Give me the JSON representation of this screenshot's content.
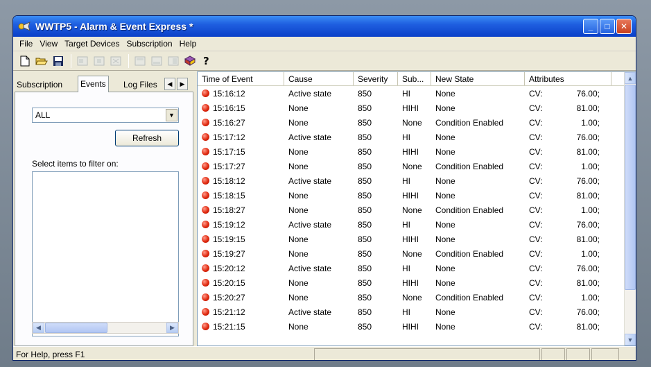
{
  "window": {
    "title": "WWTP5 - Alarm & Event Express *",
    "controls": {
      "minimize": "_",
      "maximize": "□",
      "close": "✕"
    }
  },
  "menu": [
    "File",
    "View",
    "Target Devices",
    "Subscription",
    "Help"
  ],
  "toolbar": {
    "icons": [
      "new-file-icon",
      "open-folder-icon",
      "save-icon",
      "tool-icon-1",
      "tool-icon-2",
      "tool-icon-3",
      "tool-icon-4",
      "tool-icon-5",
      "tool-icon-6",
      "book-icon",
      "help-icon"
    ]
  },
  "left_panel": {
    "tabs": [
      "Subscription",
      "Events",
      "Log Files"
    ],
    "active_tab": "Events",
    "filter_value": "ALL",
    "refresh_label": "Refresh",
    "filter_label": "Select items to filter on:"
  },
  "grid": {
    "columns": [
      "Time of Event",
      "Cause",
      "Severity",
      "Sub...",
      "New State",
      "Attributes"
    ],
    "rows": [
      {
        "time": "15:16:12",
        "cause": "Active state",
        "severity": "850",
        "sub": "HI",
        "state": "None",
        "attr_label": "CV:",
        "attr_value": "76.00;"
      },
      {
        "time": "15:16:15",
        "cause": "None",
        "severity": "850",
        "sub": "HIHI",
        "state": "None",
        "attr_label": "CV:",
        "attr_value": "81.00;"
      },
      {
        "time": "15:16:27",
        "cause": "None",
        "severity": "850",
        "sub": "None",
        "state": "Condition Enabled",
        "attr_label": "CV:",
        "attr_value": "1.00;"
      },
      {
        "time": "15:17:12",
        "cause": "Active state",
        "severity": "850",
        "sub": "HI",
        "state": "None",
        "attr_label": "CV:",
        "attr_value": "76.00;"
      },
      {
        "time": "15:17:15",
        "cause": "None",
        "severity": "850",
        "sub": "HIHI",
        "state": "None",
        "attr_label": "CV:",
        "attr_value": "81.00;"
      },
      {
        "time": "15:17:27",
        "cause": "None",
        "severity": "850",
        "sub": "None",
        "state": "Condition Enabled",
        "attr_label": "CV:",
        "attr_value": "1.00;"
      },
      {
        "time": "15:18:12",
        "cause": "Active state",
        "severity": "850",
        "sub": "HI",
        "state": "None",
        "attr_label": "CV:",
        "attr_value": "76.00;"
      },
      {
        "time": "15:18:15",
        "cause": "None",
        "severity": "850",
        "sub": "HIHI",
        "state": "None",
        "attr_label": "CV:",
        "attr_value": "81.00;"
      },
      {
        "time": "15:18:27",
        "cause": "None",
        "severity": "850",
        "sub": "None",
        "state": "Condition Enabled",
        "attr_label": "CV:",
        "attr_value": "1.00;"
      },
      {
        "time": "15:19:12",
        "cause": "Active state",
        "severity": "850",
        "sub": "HI",
        "state": "None",
        "attr_label": "CV:",
        "attr_value": "76.00;"
      },
      {
        "time": "15:19:15",
        "cause": "None",
        "severity": "850",
        "sub": "HIHI",
        "state": "None",
        "attr_label": "CV:",
        "attr_value": "81.00;"
      },
      {
        "time": "15:19:27",
        "cause": "None",
        "severity": "850",
        "sub": "None",
        "state": "Condition Enabled",
        "attr_label": "CV:",
        "attr_value": "1.00;"
      },
      {
        "time": "15:20:12",
        "cause": "Active state",
        "severity": "850",
        "sub": "HI",
        "state": "None",
        "attr_label": "CV:",
        "attr_value": "76.00;"
      },
      {
        "time": "15:20:15",
        "cause": "None",
        "severity": "850",
        "sub": "HIHI",
        "state": "None",
        "attr_label": "CV:",
        "attr_value": "81.00;"
      },
      {
        "time": "15:20:27",
        "cause": "None",
        "severity": "850",
        "sub": "None",
        "state": "Condition Enabled",
        "attr_label": "CV:",
        "attr_value": "1.00;"
      },
      {
        "time": "15:21:12",
        "cause": "Active state",
        "severity": "850",
        "sub": "HI",
        "state": "None",
        "attr_label": "CV:",
        "attr_value": "76.00;"
      },
      {
        "time": "15:21:15",
        "cause": "None",
        "severity": "850",
        "sub": "HIHI",
        "state": "None",
        "attr_label": "CV:",
        "attr_value": "81.00;"
      }
    ]
  },
  "status": {
    "text": "For Help, press F1"
  },
  "colors": {
    "title_bar": "#1f5fe0",
    "alarm_dot": "#e02a10",
    "window_bg": "#ece9d8"
  }
}
